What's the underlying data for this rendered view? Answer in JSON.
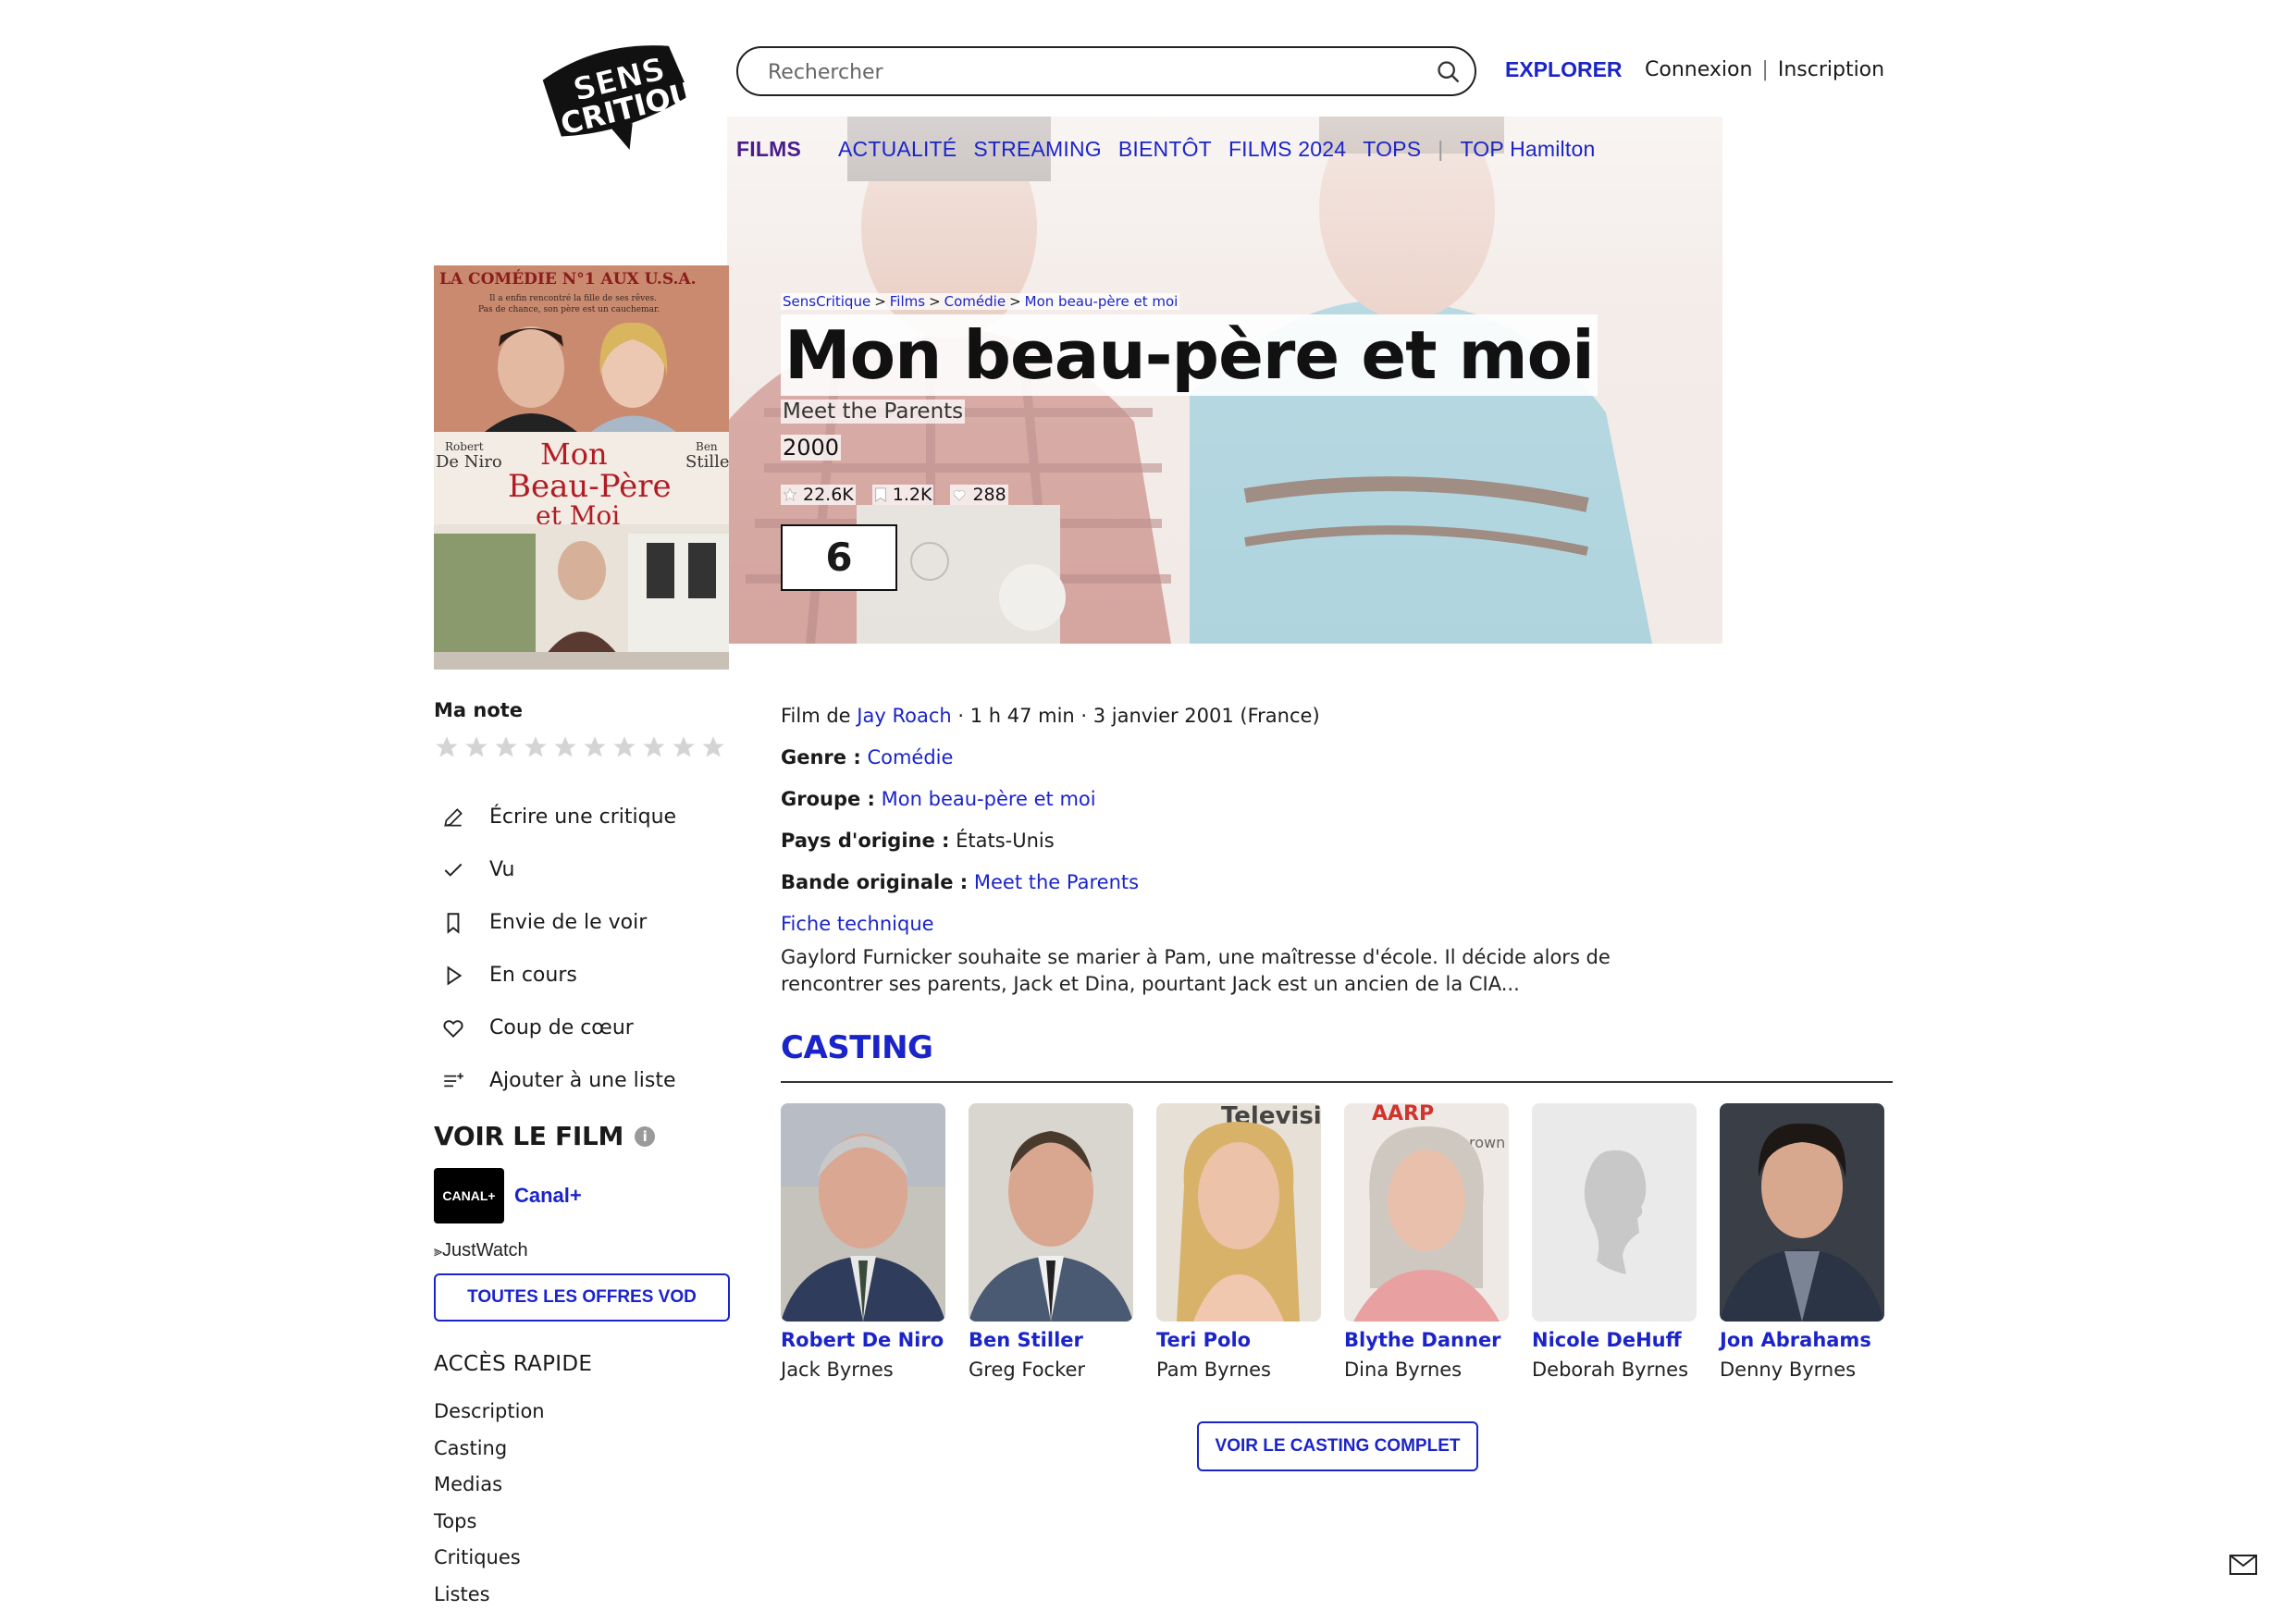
{
  "header": {
    "logo_text_top": "SENS",
    "logo_text_bottom": "CRITIQUE",
    "search_placeholder": "Rechercher",
    "explorer_label": "EXPLORER",
    "login_label": "Connexion",
    "signup_label": "Inscription"
  },
  "nav": {
    "active": "FILMS",
    "items": [
      "ACTUALITÉ",
      "STREAMING",
      "BIENTÔT",
      "FILMS 2024",
      "TOPS"
    ],
    "extra": "TOP Hamilton"
  },
  "breadcrumb": [
    "SensCritique",
    "Films",
    "Comédie",
    "Mon beau-père et moi"
  ],
  "film": {
    "title": "Mon beau-père et moi",
    "original_title": "Meet the Parents",
    "year": "2000",
    "ratings_count": "22.6K",
    "wishlist_count": "1.2K",
    "favorites_count": "288",
    "score": "6"
  },
  "poster": {
    "tagline": "LA COMÉDIE N°1 AUX U.S.A.",
    "subline_1": "Il a enfin rencontré la fille de ses rêves.",
    "subline_2": "Pas de chance, son père est un cauchemar.",
    "actor_left_1": "Robert",
    "actor_left_2": "De Niro",
    "actor_right_1": "Ben",
    "actor_right_2": "Stiller",
    "poster_title_1": "Mon",
    "poster_title_2": "Beau-Père",
    "poster_title_3": "et Moi"
  },
  "my_rating": {
    "label": "Ma note",
    "stars_total": 10,
    "stars_filled": 0
  },
  "actions": [
    {
      "label": "Écrire une critique",
      "icon": "pencil-icon"
    },
    {
      "label": "Vu",
      "icon": "check-icon"
    },
    {
      "label": "Envie de le voir",
      "icon": "bookmark-icon"
    },
    {
      "label": "En cours",
      "icon": "play-icon"
    },
    {
      "label": "Coup de cœur",
      "icon": "heart-icon"
    },
    {
      "label": "Ajouter à une liste",
      "icon": "list-add-icon"
    }
  ],
  "watch": {
    "title": "VOIR LE FILM",
    "provider_logo": "CANAL+",
    "provider_name": "Canal+",
    "justwatch": "JustWatch",
    "vod_button": "TOUTES LES OFFRES VOD"
  },
  "quick_access": {
    "title": "ACCÈS RAPIDE",
    "items": [
      "Description",
      "Casting",
      "Medias",
      "Tops",
      "Critiques",
      "Listes"
    ]
  },
  "info": {
    "film_by_label": "Film de",
    "director": "Jay Roach",
    "details": " · 1 h 47 min · 3 janvier 2001 (France)",
    "genre_label": "Genre :",
    "genre": "Comédie",
    "group_label": "Groupe :",
    "group": "Mon beau-père et moi",
    "country_label": "Pays d'origine :",
    "country": "États-Unis",
    "vo_label": "Bande originale :",
    "vo": "Meet the Parents",
    "tech_sheet": "Fiche technique"
  },
  "synopsis": "Gaylord Furnicker souhaite se marier à Pam, une maîtresse d'école. Il décide alors de rencontrer ses parents, Jack et Dina, pourtant Jack est un ancien de la CIA...",
  "casting": {
    "title": "CASTING",
    "members": [
      {
        "name": "Robert De Niro",
        "role": "Jack Byrnes"
      },
      {
        "name": "Ben Stiller",
        "role": "Greg Focker"
      },
      {
        "name": "Teri Polo",
        "role": "Pam Byrnes"
      },
      {
        "name": "Blythe Danner",
        "role": "Dina Byrnes"
      },
      {
        "name": "Nicole DeHuff",
        "role": "Deborah Byrnes"
      },
      {
        "name": "Jon Abrahams",
        "role": "Denny Byrnes"
      }
    ],
    "full_button": "VOIR LE CASTING COMPLET"
  },
  "colors": {
    "accent": "#1b24c9",
    "active_nav": "#4a1d8a",
    "text": "#1a1a1a"
  }
}
